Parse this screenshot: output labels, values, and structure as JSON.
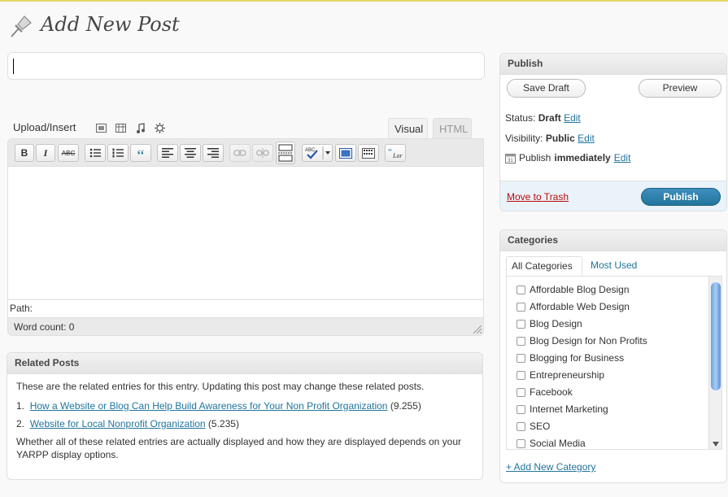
{
  "page": {
    "title": "Add New Post"
  },
  "post_title": {
    "value": ""
  },
  "media": {
    "upload_label": "Upload/Insert"
  },
  "editor": {
    "tabs": [
      "Visual",
      "HTML"
    ],
    "path_label": "Path:",
    "word_count_label": "Word count: 0",
    "toolbar": {
      "bold": "B",
      "italic": "I",
      "strike": "ABC",
      "blockquote": "“"
    }
  },
  "related": {
    "title": "Related Posts",
    "intro": "These are the related entries for this entry. Updating this post may change these related posts.",
    "items": [
      {
        "num": "1.",
        "title": "How a Website or Blog Can Help Build Awareness for Your Non Profit Organization",
        "score": "(9.255)"
      },
      {
        "num": "2.",
        "title": "Website for Local Nonprofit Organization",
        "score": "(5.235)"
      }
    ],
    "footer": "Whether all of these related entries are actually displayed and how they are displayed depends on your YARPP display options."
  },
  "publish": {
    "title": "Publish",
    "save_draft": "Save Draft",
    "preview": "Preview",
    "status_label": "Status:",
    "status_value": "Draft",
    "visibility_label": "Visibility:",
    "visibility_value": "Public",
    "publish_label": "Publish",
    "publish_value": "immediately",
    "edit": "Edit",
    "trash": "Move to Trash",
    "publish_button": "Publish"
  },
  "categories": {
    "title": "Categories",
    "tab_all": "All Categories",
    "tab_most": "Most Used",
    "items": [
      "Affordable Blog Design",
      "Affordable Web Design",
      "Blog Design",
      "Blog Design for Non Profits",
      "Blogging for Business",
      "Entrepreneurship",
      "Facebook",
      "Internet Marketing",
      "SEO",
      "Social Media"
    ],
    "add_new": "+ Add New Category"
  }
}
